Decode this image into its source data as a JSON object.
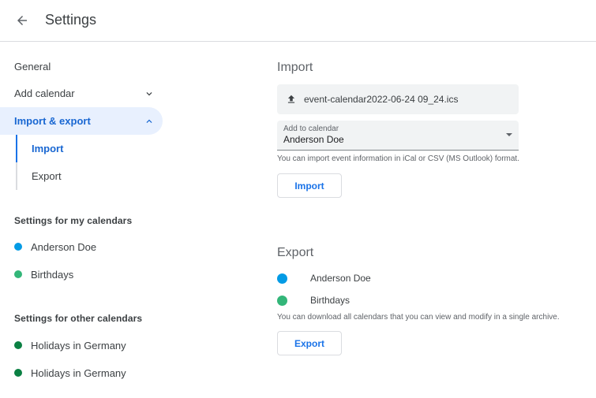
{
  "header": {
    "back_icon": "arrow-back-icon",
    "title": "Settings"
  },
  "sidebar": {
    "general": "General",
    "add_calendar": "Add calendar",
    "import_export": "Import & export",
    "sub_import": "Import",
    "sub_export": "Export",
    "my_calendars_heading": "Settings for my calendars",
    "my_calendars": [
      {
        "name": "Anderson Doe",
        "color": "#039be5"
      },
      {
        "name": "Birthdays",
        "color": "#33b679"
      }
    ],
    "other_calendars_heading": "Settings for other calendars",
    "other_calendars": [
      {
        "name": "Holidays in Germany",
        "color": "#0b8043"
      },
      {
        "name": "Holidays in Germany",
        "color": "#0b8043"
      }
    ]
  },
  "import": {
    "heading": "Import",
    "file_name": "event-calendar2022-06-24 09_24.ics",
    "file_icon": "upload-icon",
    "select_label": "Add to calendar",
    "select_value": "Anderson Doe",
    "hint": "You can import event information in iCal or CSV (MS Outlook) format.",
    "button": "Import"
  },
  "export": {
    "heading": "Export",
    "calendars": [
      {
        "name": "Anderson Doe",
        "color": "#039be5"
      },
      {
        "name": "Birthdays",
        "color": "#33b679"
      }
    ],
    "hint": "You can download all calendars that you can view and modify in a single archive.",
    "button": "Export"
  },
  "colors": {
    "accent": "#1a73e8",
    "active_bg": "#e8f0fe"
  }
}
